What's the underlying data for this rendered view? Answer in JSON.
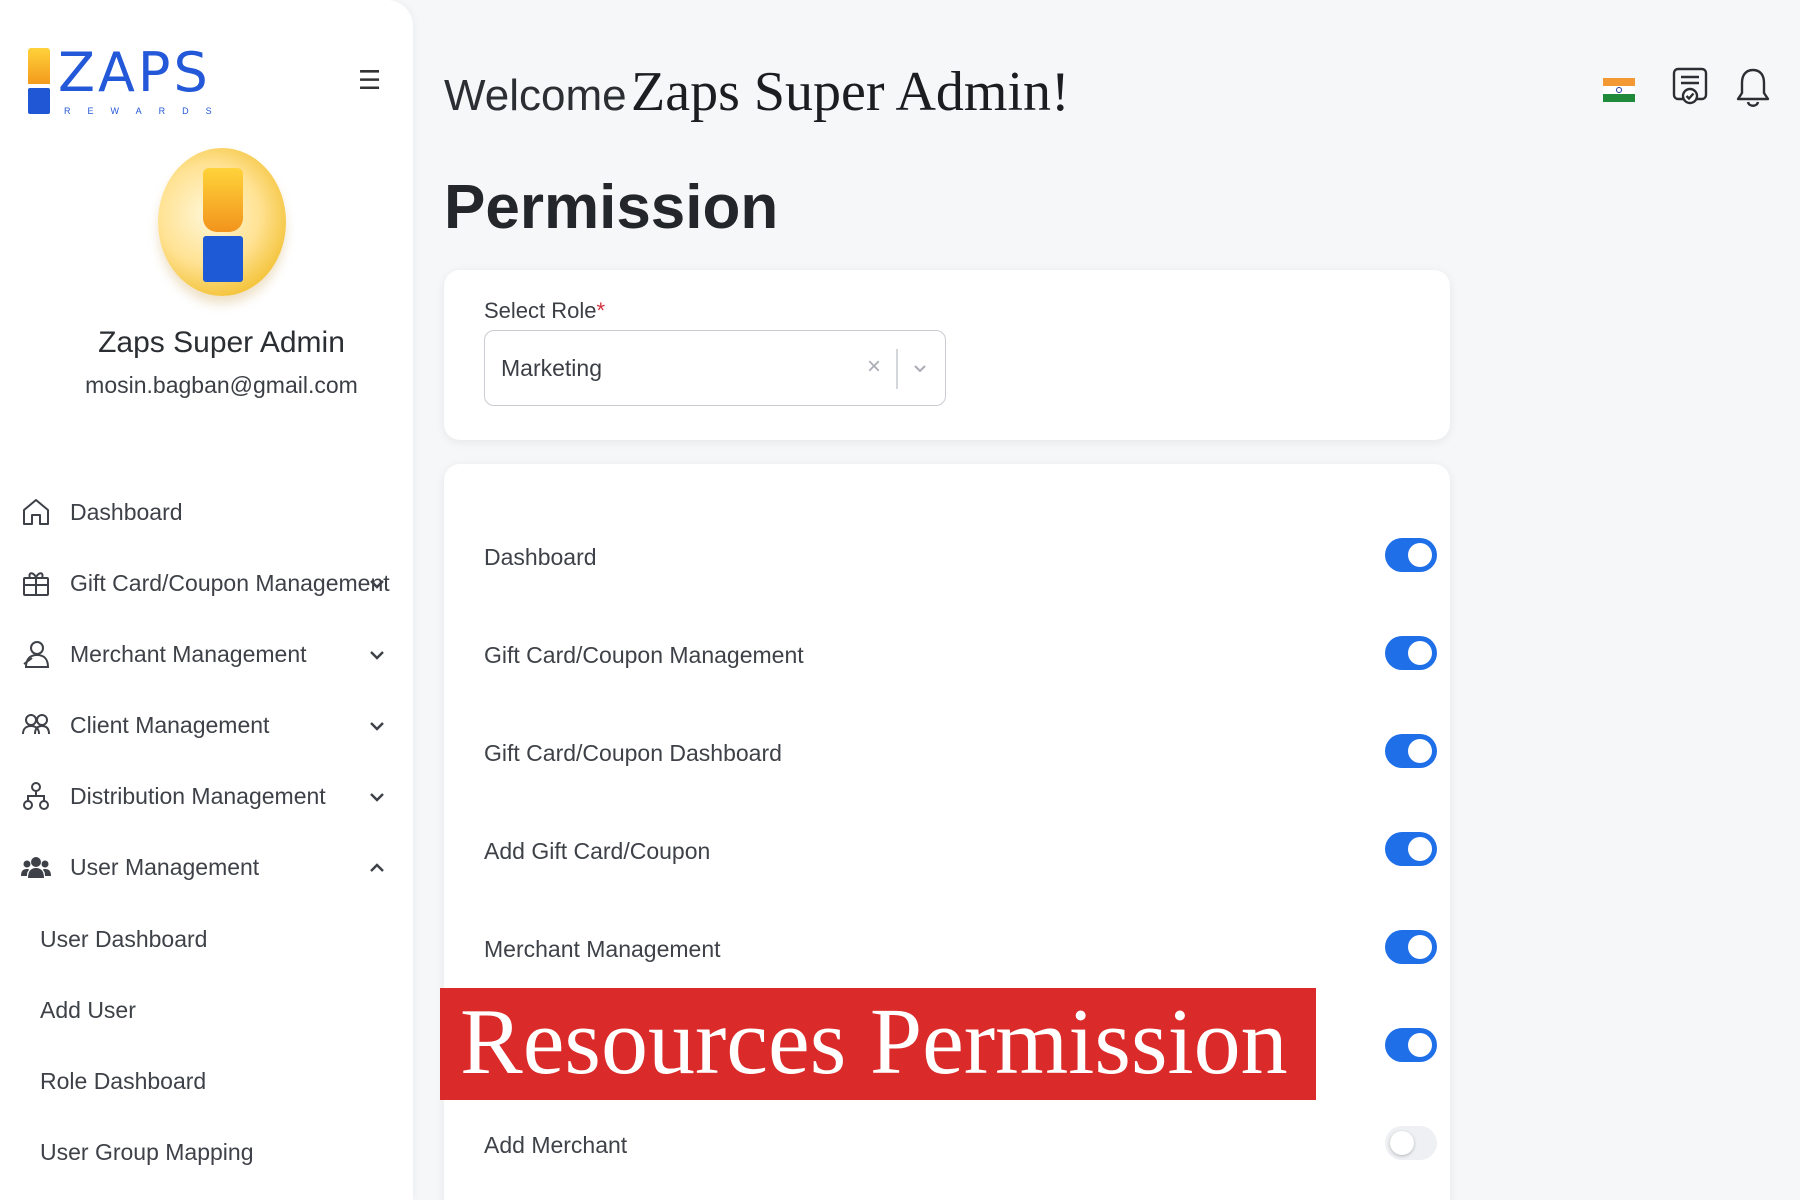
{
  "brand": {
    "logo_text": "ZAPS",
    "logo_subtext": "REWARDS"
  },
  "profile": {
    "name": "Zaps Super Admin",
    "email": "mosin.bagban@gmail.com"
  },
  "nav": {
    "items": [
      {
        "label": "Dashboard",
        "icon": "home-icon"
      },
      {
        "label": "Gift Card/Coupon Management",
        "icon": "gift-icon",
        "expanded": false
      },
      {
        "label": "Merchant Management",
        "icon": "merchant-icon",
        "expanded": false
      },
      {
        "label": "Client Management",
        "icon": "users-icon",
        "expanded": false
      },
      {
        "label": "Distribution Management",
        "icon": "network-icon",
        "expanded": false
      },
      {
        "label": "User Management",
        "icon": "user-group-icon",
        "expanded": true
      }
    ],
    "user_management_subitems": [
      "User Dashboard",
      "Add User",
      "Role Dashboard",
      "User Group Mapping"
    ]
  },
  "header": {
    "welcome_prefix": "Welcome",
    "welcome_name": "Zaps Super Admin!",
    "icons": [
      "india-flag-icon",
      "certificate-icon",
      "bell-icon"
    ]
  },
  "page": {
    "title": "Permission"
  },
  "role_form": {
    "label": "Select Role",
    "required_mark": "*",
    "selected_value": "Marketing",
    "clear_glyph": "×"
  },
  "permissions": [
    {
      "label": "Dashboard",
      "enabled": true
    },
    {
      "label": "Gift Card/Coupon Management",
      "enabled": true
    },
    {
      "label": "Gift Card/Coupon Dashboard",
      "enabled": true
    },
    {
      "label": "Add Gift Card/Coupon",
      "enabled": true
    },
    {
      "label": "Merchant Management",
      "enabled": true
    },
    {
      "label": "",
      "enabled": true
    },
    {
      "label": "Add Merchant",
      "enabled": false
    }
  ],
  "overlay": {
    "text": "Resources Permission"
  },
  "colors": {
    "brand_blue": "#2358d8",
    "toggle_on": "#1f6fe8",
    "toggle_off": "#eef0f3",
    "banner_red": "#db2a2a",
    "required_red": "#d22f3b"
  }
}
